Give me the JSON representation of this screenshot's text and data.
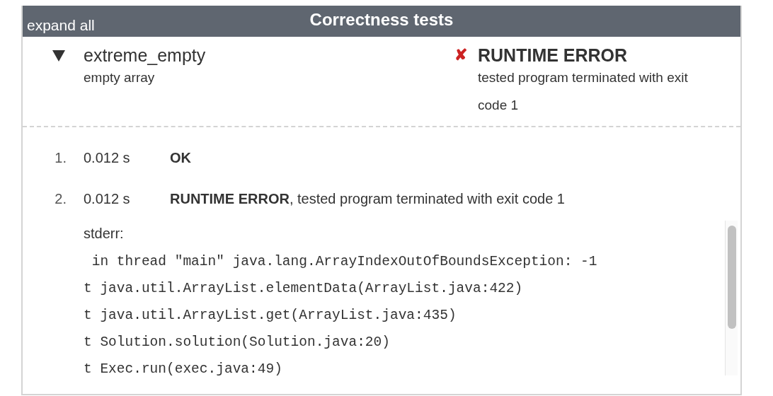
{
  "header": {
    "expand_link": "expand all",
    "title": "Correctness tests"
  },
  "tests": [
    {
      "name": "extreme_empty",
      "description": "empty array",
      "expanded": true,
      "status_icon": "✘",
      "status": "RUNTIME ERROR",
      "status_detail": "tested program terminated with exit code 1",
      "runs": [
        {
          "index": "1.",
          "time": "0.012 s",
          "verdict": "OK"
        },
        {
          "index": "2.",
          "time": "0.012 s",
          "verdict": "RUNTIME ERROR",
          "message": ", tested program terminated with exit code 1",
          "stderr_label": "stderr:",
          "stderr_lines": [
            " in thread \"main\" java.lang.ArrayIndexOutOfBoundsException: -1",
            "t java.util.ArrayList.elementData(ArrayList.java:422)",
            "t java.util.ArrayList.get(ArrayList.java:435)",
            "t Solution.solution(Solution.java:20)",
            "t Exec.run(exec.java:49)"
          ]
        }
      ]
    }
  ]
}
